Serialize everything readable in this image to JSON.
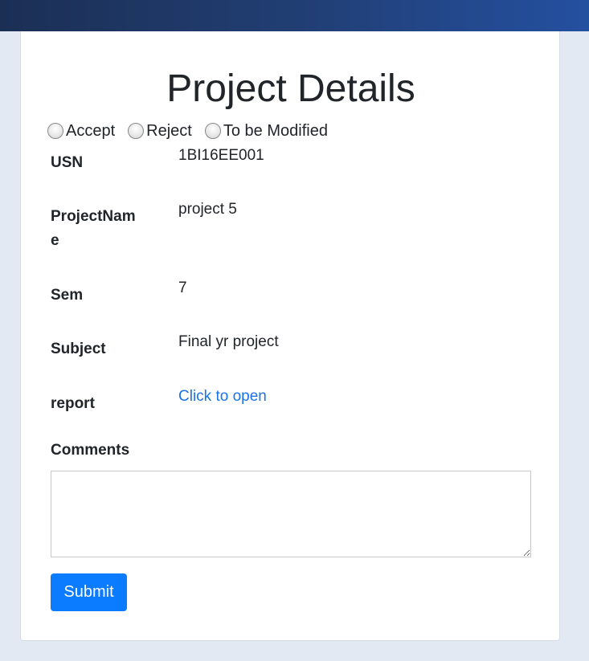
{
  "page": {
    "title": "Project Details"
  },
  "decision": {
    "options": [
      "Accept",
      "Reject",
      "To be Modified"
    ]
  },
  "details": {
    "usn_label": "USN",
    "usn_value": "1BI16EE001",
    "project_name_label": "ProjectNam e",
    "project_name_line1": "ProjectNam",
    "project_name_line2": "e",
    "project_name_value": "project 5",
    "sem_label": "Sem",
    "sem_value": "7",
    "subject_label": "Subject",
    "subject_value": "Final yr project",
    "report_label": "report",
    "report_link": "Click to open"
  },
  "comments": {
    "label": "Comments",
    "value": ""
  },
  "actions": {
    "submit_label": "Submit"
  },
  "colors": {
    "header_gradient_start": "#1b2f55",
    "header_gradient_end": "#2450a0",
    "page_background": "#e3e9f2",
    "link": "#1a73e8",
    "primary_button": "#0b7bff"
  }
}
